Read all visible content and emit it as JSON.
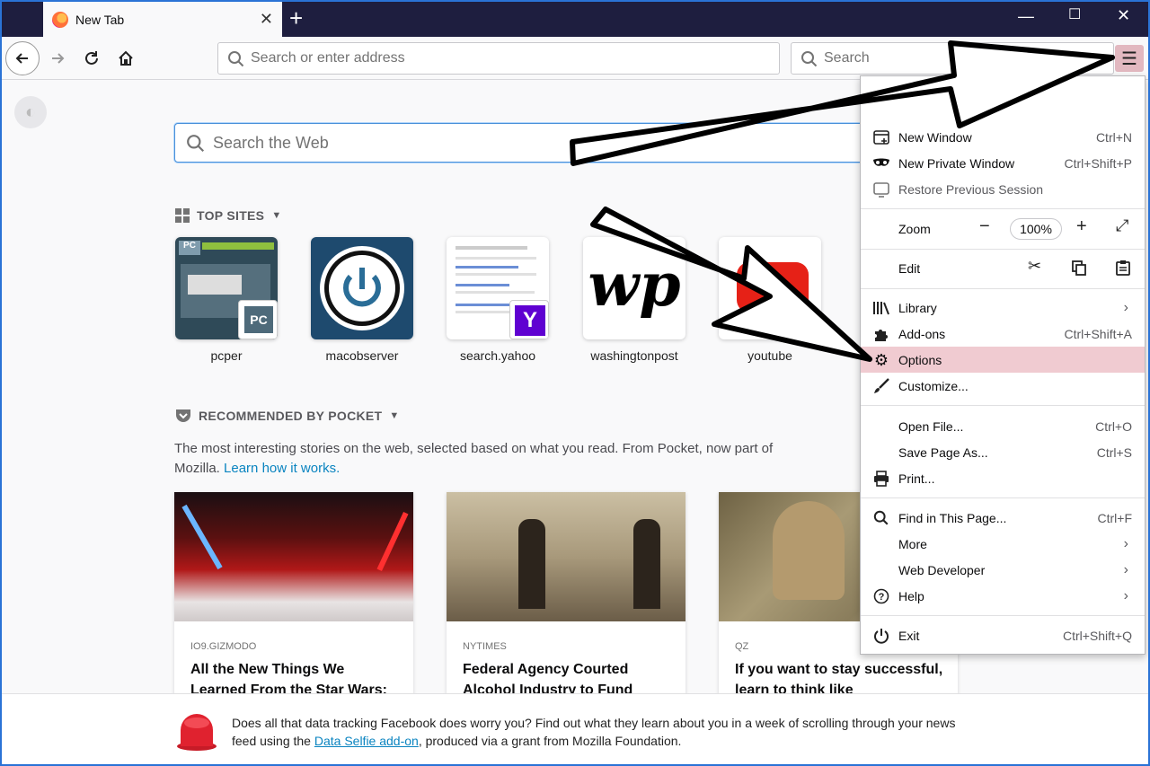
{
  "tab": {
    "title": "New Tab"
  },
  "toolbar": {
    "url_placeholder": "Search or enter address",
    "search_placeholder": "Search"
  },
  "content": {
    "web_search_placeholder": "Search the Web",
    "top_sites": {
      "heading": "TOP SITES",
      "sites": [
        {
          "label": "pcper"
        },
        {
          "label": "macobserver"
        },
        {
          "label": "search.yahoo"
        },
        {
          "label": "washingtonpost"
        },
        {
          "label": "youtube"
        }
      ]
    },
    "pocket": {
      "heading": "RECOMMENDED BY POCKET",
      "description": "The most interesting stories on the web, selected based on what you read. From Pocket, now part of Mozilla.",
      "learn_link": "Learn how it works.",
      "cards": [
        {
          "source": "IO9.GIZMODO",
          "title": "All the New Things We Learned From the Star Wars:"
        },
        {
          "source": "NYTIMES",
          "title": "Federal Agency Courted Alcohol Industry to Fund"
        },
        {
          "source": "QZ",
          "title": "If you want to stay successful, learn to think like"
        }
      ]
    }
  },
  "snippet": {
    "text_before": "Does all that data tracking Facebook does worry you? Find out what they learn about you in a week of scrolling through your news feed using the ",
    "link": "Data Selfie add-on",
    "text_after": ", produced via a grant from Mozilla Foundation."
  },
  "menu": {
    "new_window": {
      "label": "New Window",
      "shortcut": "Ctrl+N"
    },
    "new_private": {
      "label": "New Private Window",
      "shortcut": "Ctrl+Shift+P"
    },
    "restore": {
      "label": "Restore Previous Session"
    },
    "zoom": {
      "label": "Zoom",
      "value": "100%"
    },
    "edit": {
      "label": "Edit"
    },
    "library": {
      "label": "Library"
    },
    "addons": {
      "label": "Add-ons",
      "shortcut": "Ctrl+Shift+A"
    },
    "options": {
      "label": "Options"
    },
    "customize": {
      "label": "Customize..."
    },
    "open_file": {
      "label": "Open File...",
      "shortcut": "Ctrl+O"
    },
    "save_page": {
      "label": "Save Page As...",
      "shortcut": "Ctrl+S"
    },
    "print": {
      "label": "Print..."
    },
    "find": {
      "label": "Find in This Page...",
      "shortcut": "Ctrl+F"
    },
    "more": {
      "label": "More"
    },
    "web_dev": {
      "label": "Web Developer"
    },
    "help": {
      "label": "Help"
    },
    "exit": {
      "label": "Exit",
      "shortcut": "Ctrl+Shift+Q"
    }
  }
}
